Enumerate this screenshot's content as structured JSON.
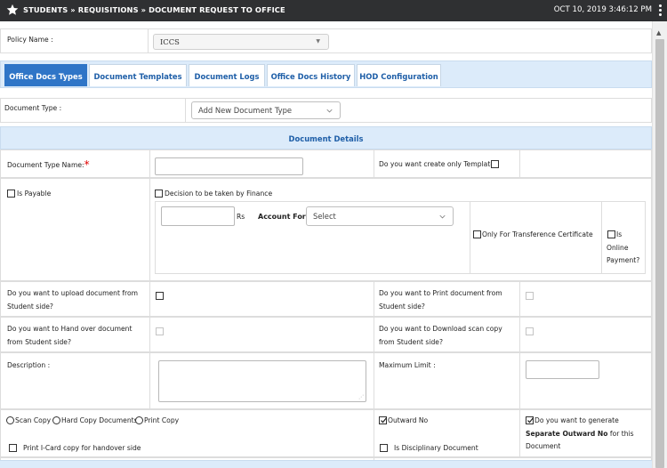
{
  "header": {
    "breadcrumb": "STUDENTS » REQUISITIONS » DOCUMENT REQUEST TO OFFICE",
    "datetime": "OCT 10, 2019  3:46:12 PM"
  },
  "policy": {
    "label": "Policy Name :",
    "value": "ICCS"
  },
  "tabs": [
    {
      "label": "Office Docs Types",
      "active": true
    },
    {
      "label": "Document Templates",
      "active": false
    },
    {
      "label": "Document Logs",
      "active": false
    },
    {
      "label": "Office Docs History",
      "active": false
    },
    {
      "label": "HOD Configuration",
      "active": false
    }
  ],
  "document_type": {
    "label": "Document Type :",
    "value": "Add New Document Type"
  },
  "section_title": "Document Details",
  "form": {
    "doc_type_name_label": "Document Type Name:",
    "required_mark": "*",
    "only_template_label": "Do you want create only Template",
    "is_payable_label": "Is Payable",
    "finance_label": "Decision to be taken by Finance",
    "rs_label": "Rs",
    "account_for_label": "Account For",
    "account_for_value": "Select",
    "transference_label": "Only For Transference Certificate",
    "online_payment_line1": "Is",
    "online_payment_line2": "Online",
    "online_payment_line3": "Payment?",
    "upload_line1": "Do you want to upload document from",
    "upload_line2": "Student side?",
    "print_line1": "Do you want to Print document from",
    "print_line2": "Student side?",
    "handover_line1": "Do you want to Hand over document",
    "handover_line2": "from Student side?",
    "download_line1": "Do you want to Download scan copy",
    "download_line2": "from Student side?",
    "description_label": "Description :",
    "max_limit_label": "Maximum Limit :",
    "scan_copy_label": "Scan Copy",
    "hard_copy_label": "Hard Copy Documents",
    "print_copy_label": "Print Copy",
    "outward_no_label": "Outward No",
    "generate_line1": "Do you want to generate",
    "generate_bold": "Separate Outward No",
    "generate_line2_rest": " for this",
    "generate_line3": "Document",
    "icard_label": "Print I-Card copy for handover side",
    "disciplinary_label": "Is Disciplinary Document"
  }
}
